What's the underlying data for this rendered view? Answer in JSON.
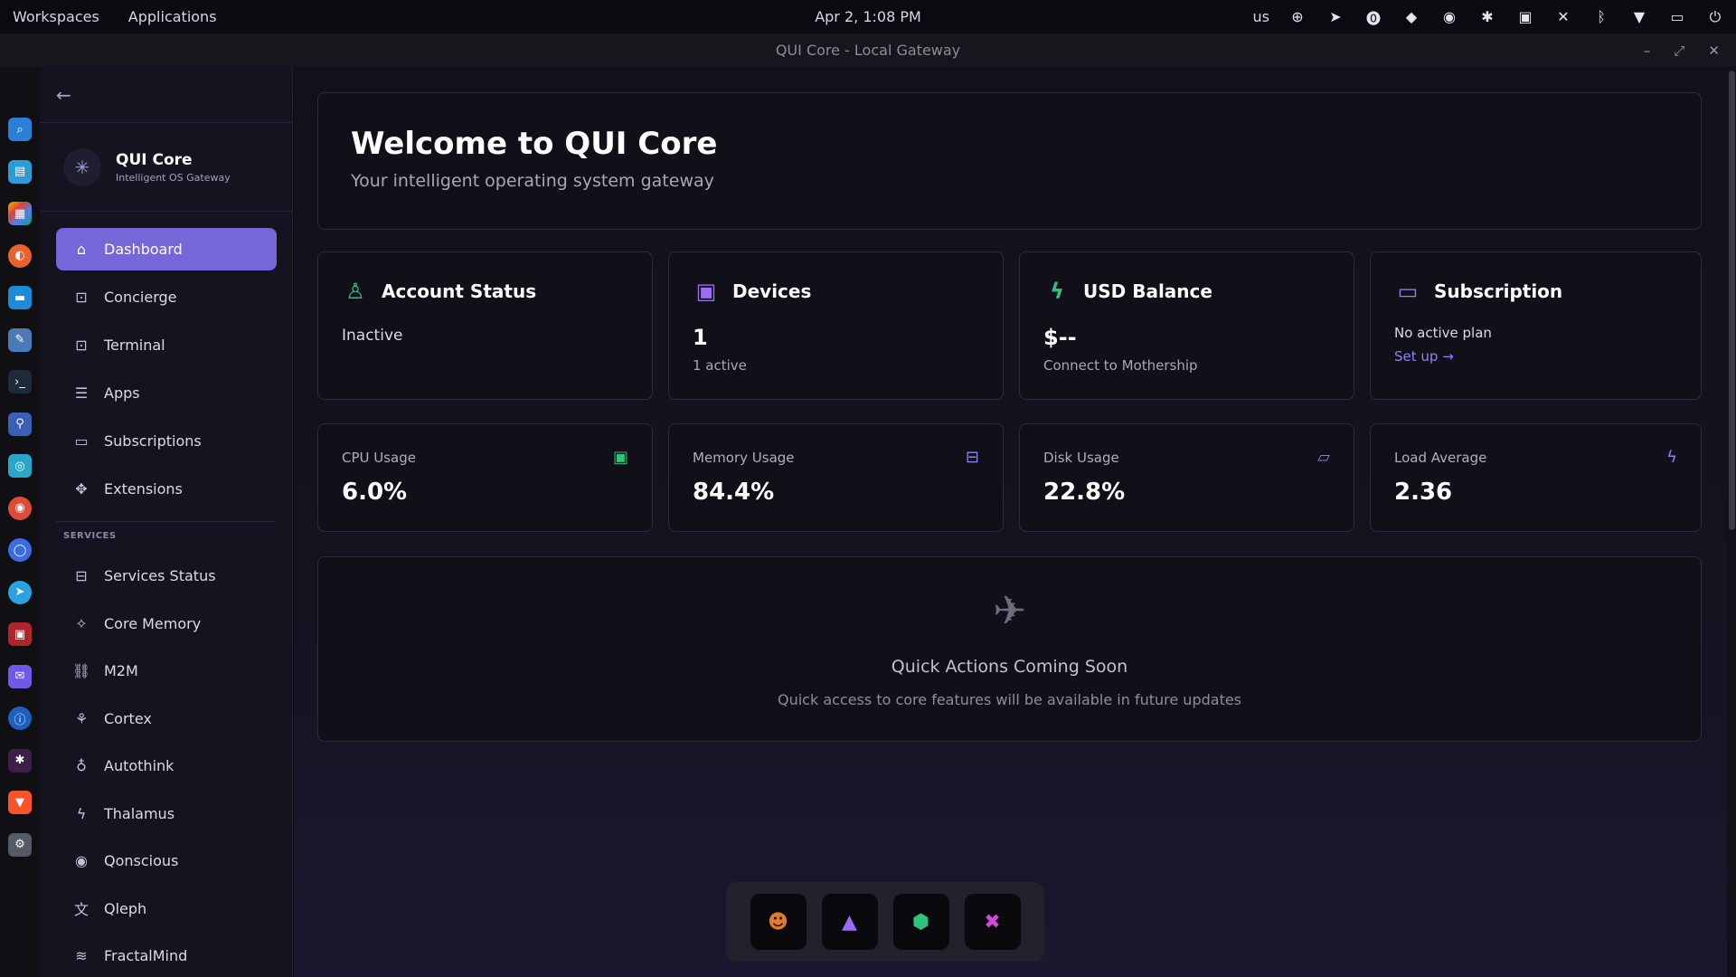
{
  "topbar": {
    "workspaces": "Workspaces",
    "applications": "Applications",
    "clock": "Apr 2, 1:08 PM",
    "keyboard": "us"
  },
  "window": {
    "title": "QUI Core - Local Gateway"
  },
  "sidebar": {
    "brand_title": "QUI Core",
    "brand_sub": "Intelligent OS Gateway",
    "items": [
      {
        "label": "Dashboard"
      },
      {
        "label": "Concierge"
      },
      {
        "label": "Terminal"
      },
      {
        "label": "Apps"
      },
      {
        "label": "Subscriptions"
      },
      {
        "label": "Extensions"
      }
    ],
    "section_label": "SERVICES",
    "services": [
      {
        "label": "Services Status"
      },
      {
        "label": "Core Memory"
      },
      {
        "label": "M2M"
      },
      {
        "label": "Cortex"
      },
      {
        "label": "Autothink"
      },
      {
        "label": "Thalamus"
      },
      {
        "label": "Qonscious"
      },
      {
        "label": "Qleph"
      },
      {
        "label": "FractalMind"
      }
    ]
  },
  "welcome": {
    "title": "Welcome to QUI Core",
    "subtitle": "Your intelligent operating system gateway"
  },
  "stats": {
    "account": {
      "title": "Account Status",
      "value": "Inactive"
    },
    "devices": {
      "title": "Devices",
      "value": "1",
      "sub": "1 active"
    },
    "balance": {
      "title": "USD Balance",
      "value": "$--",
      "sub": "Connect to Mothership"
    },
    "subscription": {
      "title": "Subscription",
      "value": "No active plan",
      "link": "Set up →"
    }
  },
  "metrics": {
    "cpu": {
      "label": "CPU Usage",
      "value": "6.0%"
    },
    "memory": {
      "label": "Memory Usage",
      "value": "84.4%"
    },
    "disk": {
      "label": "Disk Usage",
      "value": "22.8%"
    },
    "load": {
      "label": "Load Average",
      "value": "2.36"
    }
  },
  "quick_actions": {
    "title": "Quick Actions Coming Soon",
    "subtitle": "Quick access to core features will be available in future updates"
  },
  "colors": {
    "accent": "#7567d8",
    "green": "#2ec27e",
    "purple": "#9b6bf2",
    "blue": "#8b86f5"
  }
}
